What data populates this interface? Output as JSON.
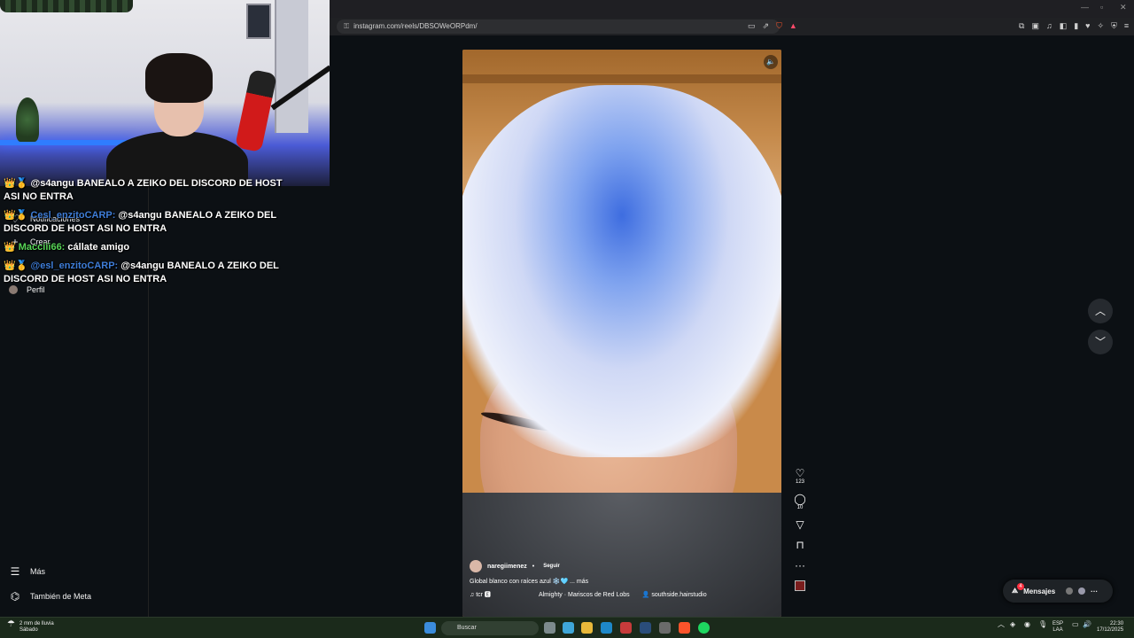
{
  "browser": {
    "url": "instagram.com/reels/DBSOWeORPdm/",
    "lock_icon": "lock-icon"
  },
  "sidebar": {
    "items": [
      {
        "label": "Notificaciones",
        "icon": "heart-icon"
      },
      {
        "label": "Crear",
        "icon": "plus-icon"
      },
      {
        "label": "Perfil",
        "icon": "avatar-icon"
      },
      {
        "label": "Más",
        "icon": "menu-icon"
      },
      {
        "label": "También de Meta",
        "icon": "meta-icon"
      }
    ]
  },
  "chat": {
    "messages": [
      {
        "badges": "👑🥇",
        "user": "",
        "text": "@s4angu BANEALO A ZEIKO DEL DISCORD DE HOST ASI NO ENTRA"
      },
      {
        "badges": "👑🥇",
        "user": "Cesl_enzitoCARP:",
        "text": "@s4angu BANEALO A ZEIKO DEL DISCORD DE HOST ASI NO ENTRA"
      },
      {
        "badges": "👑",
        "user": "Macciii66:",
        "text": "cállate amigo"
      },
      {
        "badges": "👑🥇",
        "user": "@esl_enzitoCARP:",
        "text": "@s4angu BANEALO A ZEIKO DEL DISCORD DE HOST ASI NO ENTRA"
      }
    ]
  },
  "reel": {
    "username": "naregiimenez",
    "follow": "Seguir",
    "caption": "Global blanco con raíces azul ❄️🩵 ... más",
    "audio_user": "tcr 🅴",
    "audio_track": "Almighty · Mariscos de Red Lobs",
    "tag": "southside.hairstudio",
    "likes": "123",
    "comments": "10",
    "more": "···"
  },
  "messages_button": {
    "label": "Mensajes",
    "badge": "4"
  },
  "taskbar": {
    "weather_line1": "2 mm de lluvia",
    "weather_line2": "Sábado",
    "search": "Buscar",
    "lang1": "ESP",
    "lang2": "LAA",
    "time": "22:30",
    "date": "17/12/2025"
  },
  "colors": {
    "page_bg": "#0c1014",
    "chat_user_blue": "#3e7dd8",
    "chat_user_green": "#57d657",
    "notif_red": "#ff3040"
  }
}
